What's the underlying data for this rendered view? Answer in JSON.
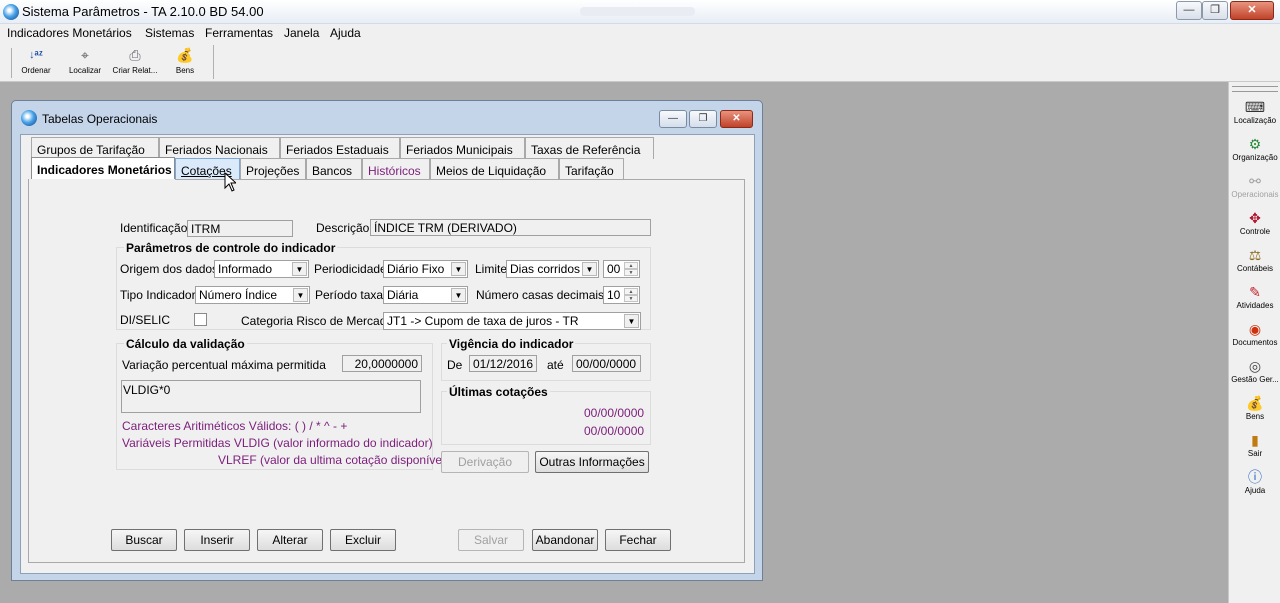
{
  "app": {
    "title": "Sistema Parâmetros -  TA 2.10.0 BD 54.00",
    "window_controls": {
      "minimize": "—",
      "maximize": "❐",
      "close": "✕"
    }
  },
  "menu": [
    "Indicadores Monetários",
    "Sistemas",
    "Ferramentas",
    "Janela",
    "Ajuda"
  ],
  "toolbar": [
    {
      "label": "Ordenar",
      "icon": "sort-icon"
    },
    {
      "label": "Localizar",
      "icon": "find-icon"
    },
    {
      "label": "Criar Relat...",
      "icon": "print-icon"
    },
    {
      "label": "Bens",
      "icon": "money-bag-icon"
    }
  ],
  "sidebar": [
    {
      "label": "Localização",
      "icon": "localization-icon",
      "enabled": true
    },
    {
      "label": "Organização",
      "icon": "organization-icon",
      "enabled": true
    },
    {
      "label": "Operacionais",
      "icon": "operations-icon",
      "enabled": false
    },
    {
      "label": "Controle",
      "icon": "control-icon",
      "enabled": true
    },
    {
      "label": "Contábeis",
      "icon": "scales-icon",
      "enabled": true
    },
    {
      "label": "Atividades",
      "icon": "activities-icon",
      "enabled": true
    },
    {
      "label": "Documentos",
      "icon": "documents-icon",
      "enabled": true
    },
    {
      "label": "Gestão Ger...",
      "icon": "management-icon",
      "enabled": true
    },
    {
      "label": "Bens",
      "icon": "money-bag-icon",
      "enabled": true
    },
    {
      "label": "Sair",
      "icon": "exit-icon",
      "enabled": true
    },
    {
      "label": "Ajuda",
      "icon": "help-icon",
      "enabled": true
    }
  ],
  "child_window": {
    "title": "Tabelas Operacionais",
    "tabs_row1": [
      "Grupos de Tarifação",
      "Feriados Nacionais",
      "Feriados Estaduais",
      "Feriados Municipais",
      "Taxas de Referência"
    ],
    "tabs_row2": [
      "Indicadores Monetários",
      "Cotações",
      "Projeções",
      "Bancos",
      "Históricos",
      "Meios de Liquidação",
      "Tarifação"
    ],
    "active_tab": "Indicadores Monetários"
  },
  "form": {
    "identificacao_label": "Identificação",
    "identificacao_value": "ITRM",
    "descricao_label": "Descrição",
    "descricao_value": "ÍNDICE TRM (DERIVADO)",
    "params_title": "Parâmetros de controle do indicador",
    "origem_label": "Origem dos dados",
    "origem_value": "Informado",
    "periodicidade_label": "Periodicidade",
    "periodicidade_value": "Diário Fixo",
    "limite_label": "Limite",
    "limite_value": "Dias corridos",
    "limite_num": "00",
    "tipo_label": "Tipo Indicador",
    "tipo_value": "Número Índice",
    "periodo_label": "Período taxa",
    "periodo_value": "Diária",
    "casas_label": "Número casas decimais",
    "casas_value": "10",
    "diselic_label": "DI/SELIC",
    "categoria_label": "Categoria Risco de Mercado",
    "categoria_value": "JT1 -> Cupom de taxa de juros - TR",
    "calc_title": "Cálculo da validação",
    "variacao_label": "Variação percentual máxima permitida",
    "variacao_value": "20,0000000",
    "formula_value": "VLDIG*0",
    "caracteres_text": "Caracteres Aritiméticos Válidos:     ( ) / * ^ - +",
    "variaveis_text": "Variáveis Permitidas VLDIG  (valor informado do indicador)",
    "vlref_text": "VLREF (valor da ultima cotação disponível)",
    "vigencia_title": "Vigência do indicador",
    "de_label": "De",
    "de_value": "01/12/2016",
    "ate_label": "até",
    "ate_value": "00/00/0000",
    "ultimas_title": "Últimas cotações",
    "ultima1": "00/00/0000",
    "ultima2": "00/00/0000",
    "derivacao_btn": "Derivação",
    "outras_btn": "Outras Informações"
  },
  "buttons": {
    "buscar": "Buscar",
    "inserir": "Inserir",
    "alterar": "Alterar",
    "excluir": "Excluir",
    "salvar": "Salvar",
    "abandonar": "Abandonar",
    "fechar": "Fechar"
  },
  "colors": {
    "desktop": "#ababab",
    "window_frame": "#c4d5ea",
    "purple_text": "#7b1e7a",
    "hover_tab": "#dbeafb"
  }
}
